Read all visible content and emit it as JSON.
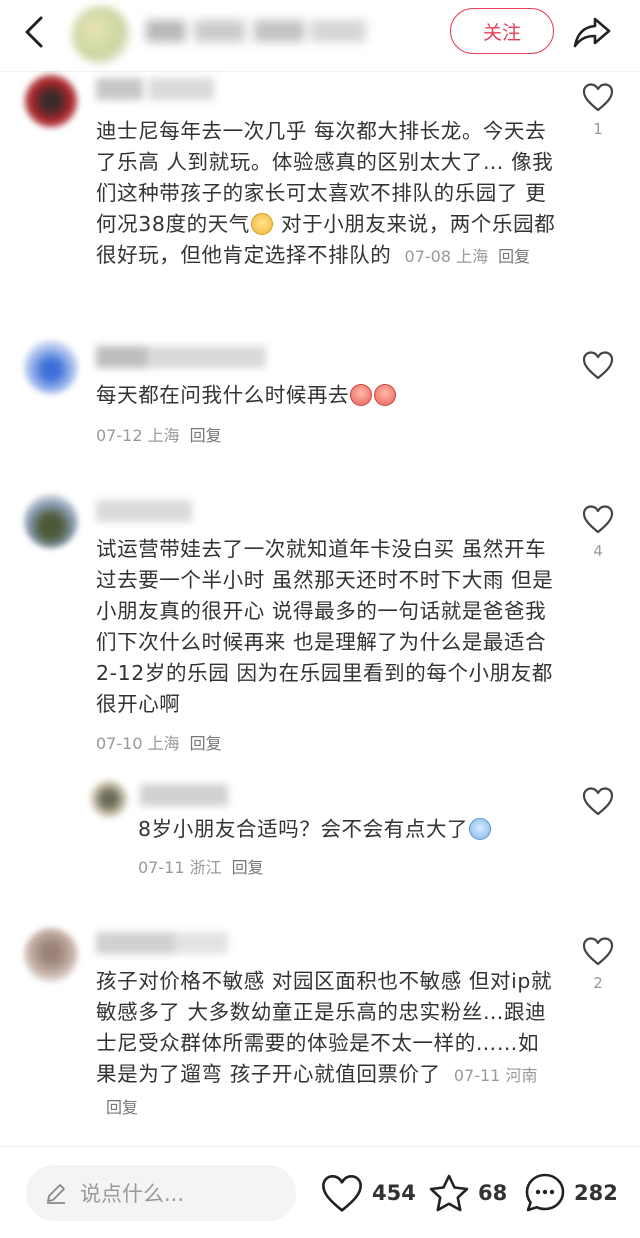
{
  "header": {
    "back_icon": "chevron-left-icon",
    "follow_label": "关注",
    "share_icon": "share-arrow-icon",
    "accent": "#e64057"
  },
  "comments": [
    {
      "text": "迪士尼每年去一次几乎 每次都大排长龙。今天去了乐高 人到就玩。体验感真的区别太大了… 像我们这种带孩子的家长可太喜欢不排队的乐园了 更何况38度的天气",
      "text_after_emoji": " 对于小朋友来说，两个乐园都很好玩，但他肯定选择不排队的",
      "date": "07-08",
      "location": "上海",
      "reply_label": "回复",
      "like_count": "1"
    },
    {
      "text": "每天都在问我什么时候再去",
      "date": "07-12",
      "location": "上海",
      "reply_label": "回复",
      "like_count": ""
    },
    {
      "text": "试运营带娃去了一次就知道年卡没白买 虽然开车过去要一个半小时 虽然那天还时不时下大雨 但是小朋友真的很开心 说得最多的一句话就是爸爸我们下次什么时候再来 也是理解了为什么是最适合2-12岁的乐园 因为在乐园里看到的每个小朋友都很开心啊",
      "date": "07-10",
      "location": "上海",
      "reply_label": "回复",
      "like_count": "4"
    },
    {
      "text": "8岁小朋友合适吗？会不会有点大了",
      "date": "07-11",
      "location": "浙江",
      "reply_label": "回复",
      "like_count": ""
    },
    {
      "text": "孩子对价格不敏感 对园区面积也不敏感 但对ip就敏感多了 大多数幼童正是乐高的忠实粉丝…跟迪士尼受众群体所需要的体验是不太一样的……如果是为了遛弯 孩子开心就值回票价了",
      "date": "07-11",
      "location": "河南",
      "reply_label": "回复",
      "like_count": "2"
    }
  ],
  "bottom_bar": {
    "input_placeholder": "说点什么...",
    "likes": "454",
    "favorites": "68",
    "comments": "282"
  }
}
